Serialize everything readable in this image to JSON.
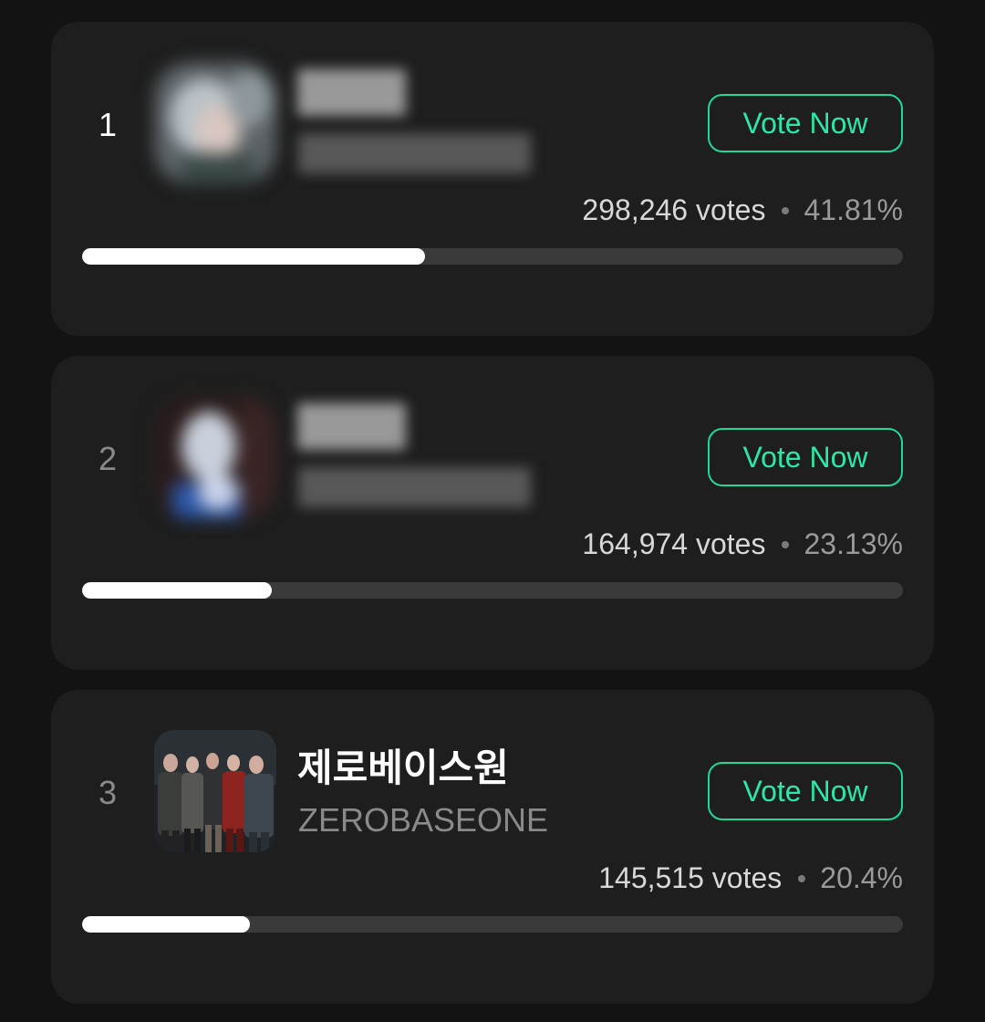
{
  "accent_color": "#1fd89a",
  "entries": [
    {
      "rank": "1",
      "name": "",
      "subname": "",
      "name_blurred": true,
      "vote_label": "Vote Now",
      "votes": "298,246 votes",
      "percent": "41.81%",
      "progress_fraction": 0.4181
    },
    {
      "rank": "2",
      "name": "",
      "subname": "",
      "name_blurred": true,
      "vote_label": "Vote Now",
      "votes": "164,974 votes",
      "percent": "23.13%",
      "progress_fraction": 0.2313
    },
    {
      "rank": "3",
      "name": "제로베이스원",
      "subname": "ZEROBASEONE",
      "name_blurred": false,
      "vote_label": "Vote Now",
      "votes": "145,515 votes",
      "percent": "20.4%",
      "progress_fraction": 0.204
    }
  ]
}
